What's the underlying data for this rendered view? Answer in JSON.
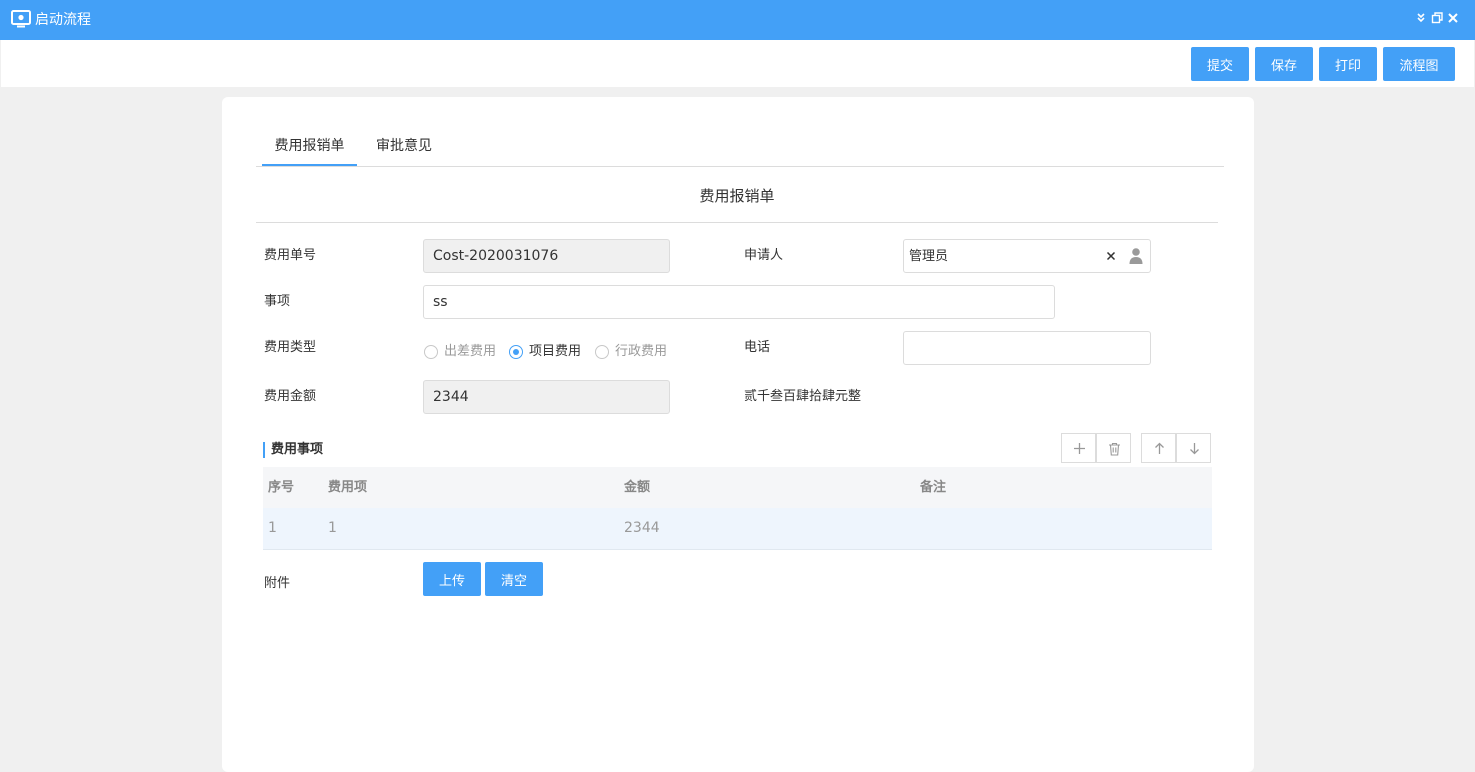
{
  "window": {
    "title": "启动流程",
    "icon": "monitor-icon",
    "controls": [
      "collapse-icon",
      "restore-icon",
      "close-icon"
    ]
  },
  "toolbar": {
    "submit_label": "提交",
    "save_label": "保存",
    "print_label": "打印",
    "flowchart_label": "流程图"
  },
  "tabs": [
    {
      "label": "费用报销单",
      "active": true
    },
    {
      "label": "审批意见",
      "active": false
    }
  ],
  "form": {
    "title": "费用报销单",
    "expense_no_label": "费用单号",
    "expense_no_value": "Cost-2020031076",
    "applicant_label": "申请人",
    "applicant_value": "管理员",
    "item_label": "事项",
    "item_value": "ss",
    "type_label": "费用类型",
    "type_options": [
      {
        "label": "出差费用",
        "checked": false
      },
      {
        "label": "项目费用",
        "checked": true
      },
      {
        "label": "行政费用",
        "checked": false
      }
    ],
    "phone_label": "电话",
    "phone_value": "",
    "amount_label": "费用金额",
    "amount_value": "2344",
    "amount_in_words": "贰千叁百肆拾肆元整"
  },
  "details": {
    "section_title": "费用事项",
    "toolbar_icons": [
      "add-icon",
      "delete-icon",
      "move-up-icon",
      "move-down-icon"
    ],
    "columns": [
      "序号",
      "费用项",
      "金额",
      "备注"
    ],
    "rows": [
      [
        "1",
        "1",
        "2344",
        ""
      ]
    ]
  },
  "attachment": {
    "label": "附件",
    "upload_label": "上传",
    "clear_label": "清空"
  },
  "colors": {
    "accent": "#43a0f7",
    "background": "#f0f0f0",
    "readonly_field": "#f0f0f0",
    "row_highlight": "#eef5fd"
  }
}
